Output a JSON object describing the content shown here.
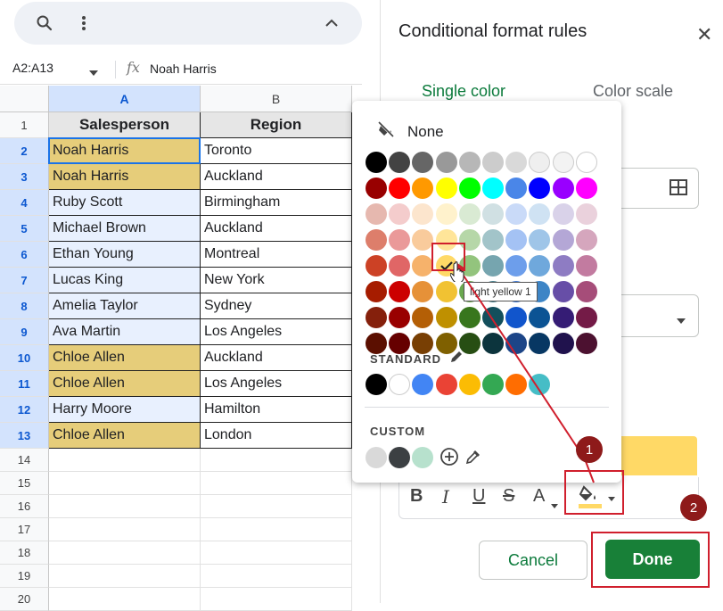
{
  "toolbar": {
    "icons": [
      "search-icon",
      "more-vert-icon",
      "chevron-up-icon"
    ]
  },
  "formula_bar": {
    "name_box": "A2:A13",
    "fx_label": "fx",
    "value": "Noah Harris"
  },
  "sheet": {
    "columns": [
      "A",
      "B"
    ],
    "header_row": {
      "row": "1",
      "a": "Salesperson",
      "b": "Region"
    },
    "rows": [
      {
        "row": "2",
        "a": "Noah Harris",
        "b": "Toronto",
        "highlight": true
      },
      {
        "row": "3",
        "a": "Noah Harris",
        "b": "Auckland",
        "highlight": true
      },
      {
        "row": "4",
        "a": "Ruby Scott",
        "b": "Birmingham",
        "highlight": false
      },
      {
        "row": "5",
        "a": "Michael Brown",
        "b": "Auckland",
        "highlight": false
      },
      {
        "row": "6",
        "a": "Ethan Young",
        "b": "Montreal",
        "highlight": false
      },
      {
        "row": "7",
        "a": "Lucas King",
        "b": "New York",
        "highlight": false
      },
      {
        "row": "8",
        "a": "Amelia Taylor",
        "b": "Sydney",
        "highlight": false
      },
      {
        "row": "9",
        "a": "Ava Martin",
        "b": "Los Angeles",
        "highlight": false
      },
      {
        "row": "10",
        "a": "Chloe Allen",
        "b": "Auckland",
        "highlight": true
      },
      {
        "row": "11",
        "a": "Chloe Allen",
        "b": "Los Angeles",
        "highlight": true
      },
      {
        "row": "12",
        "a": "Harry Moore",
        "b": "Hamilton",
        "highlight": false
      },
      {
        "row": "13",
        "a": "Chloe Allen",
        "b": "London",
        "highlight": true
      }
    ],
    "empty_rows": [
      "14",
      "15",
      "16",
      "17",
      "18",
      "19",
      "20"
    ],
    "colors": {
      "highlight": "#e6cd7a",
      "selected_range": "#e8f0fe"
    }
  },
  "panel": {
    "title": "Conditional format rules",
    "tabs": [
      "Single color",
      "Color scale"
    ],
    "format_buttons": [
      "B",
      "I",
      "U",
      "S",
      "A"
    ],
    "preview_color": "#ffd966",
    "cancel_label": "Cancel",
    "done_label": "Done"
  },
  "color_picker": {
    "none_label": "None",
    "standard_label": "STANDARD",
    "custom_label": "CUSTOM",
    "tooltip": "light yellow 1",
    "selected": "#ffe599",
    "palette": [
      [
        "#000000",
        "#434343",
        "#666666",
        "#999999",
        "#b7b7b7",
        "#cccccc",
        "#d9d9d9",
        "#efefef",
        "#f3f3f3",
        "#ffffff"
      ],
      [
        "#980000",
        "#ff0000",
        "#ff9900",
        "#ffff00",
        "#00ff00",
        "#00ffff",
        "#4a86e8",
        "#0000ff",
        "#9900ff",
        "#ff00ff"
      ],
      [
        "#e6b8af",
        "#f4cccc",
        "#fce5cd",
        "#fff2cc",
        "#d9ead3",
        "#d0e0e3",
        "#c9daf8",
        "#cfe2f3",
        "#d9d2e9",
        "#ead1dc"
      ],
      [
        "#dd7e6b",
        "#ea9999",
        "#f9cb9c",
        "#ffe599",
        "#b6d7a8",
        "#a2c4c9",
        "#a4c2f4",
        "#9fc5e8",
        "#b4a7d6",
        "#d5a6bd"
      ],
      [
        "#cc4125",
        "#e06666",
        "#f6b26b",
        "#ffd966",
        "#93c47d",
        "#76a5af",
        "#6d9eeb",
        "#6fa8dc",
        "#8e7cc3",
        "#c27ba0"
      ],
      [
        "#a61c00",
        "#cc0000",
        "#e69138",
        "#f1c232",
        "#6aa84f",
        "#45818e",
        "#3c78d8",
        "#3d85c6",
        "#674ea7",
        "#a64d79"
      ],
      [
        "#85200c",
        "#990000",
        "#b45f06",
        "#bf9000",
        "#38761d",
        "#134f5c",
        "#1155cc",
        "#0b5394",
        "#351c75",
        "#741b47"
      ],
      [
        "#5b0f00",
        "#660000",
        "#783f04",
        "#7f6000",
        "#274e13",
        "#0c343d",
        "#1c4587",
        "#073763",
        "#20124d",
        "#4c1130"
      ]
    ],
    "standard": [
      "#000000",
      "#ffffff",
      "#4285f4",
      "#ea4335",
      "#fbbc04",
      "#34a853",
      "#ff6d01",
      "#46bdc6"
    ],
    "custom": [
      "#d9d9d9",
      "#3c4043",
      "#b7e1cd"
    ]
  },
  "annotations": {
    "badge_1": "1",
    "badge_2": "2",
    "color": "#d01f2d"
  }
}
